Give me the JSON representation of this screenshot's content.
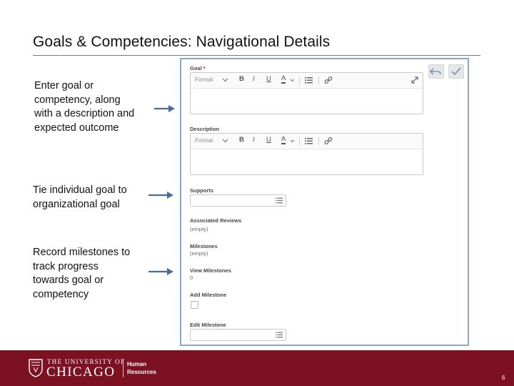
{
  "slide": {
    "title": "Goals & Competencies: Navigational Details",
    "page_number": "6"
  },
  "notes": {
    "goal": [
      "Enter goal or",
      "competency, along",
      "with a description and",
      "expected outcome"
    ],
    "tie": [
      "Tie individual goal to",
      "organizational goal"
    ],
    "milestones": [
      "Record milestones to",
      "track progress",
      "towards goal or",
      "competency"
    ]
  },
  "form": {
    "goal_label": "Goal",
    "required_mark": "*",
    "description_label": "Description",
    "toolbar": {
      "format": "Format",
      "bold": "B",
      "italic": "I",
      "underline": "U",
      "color": "A"
    },
    "supports_label": "Supports",
    "associated_reviews_label": "Associated Reviews",
    "associated_reviews_value": "(empty)",
    "milestones_label": "Milestones",
    "milestones_value": "(empty)",
    "view_milestones_label": "View Milestones",
    "view_milestones_value": "0",
    "add_milestone_label": "Add Milestone",
    "edit_milestone_label": "Edit Milestone"
  },
  "footer": {
    "university_small": "THE UNIVERSITY OF",
    "university_big": "CHICAGO",
    "dept_line1": "Human",
    "dept_line2": "Resources"
  },
  "colors": {
    "footer_bg": "#7c1122",
    "arrow": "#4a6d98",
    "panel_border": "#8aa7c4",
    "required": "#d0021b"
  },
  "icons": [
    "undo-icon",
    "check-icon",
    "expand-icon",
    "list-icon",
    "link-icon",
    "chevron-down-icon",
    "university-seal-icon"
  ]
}
